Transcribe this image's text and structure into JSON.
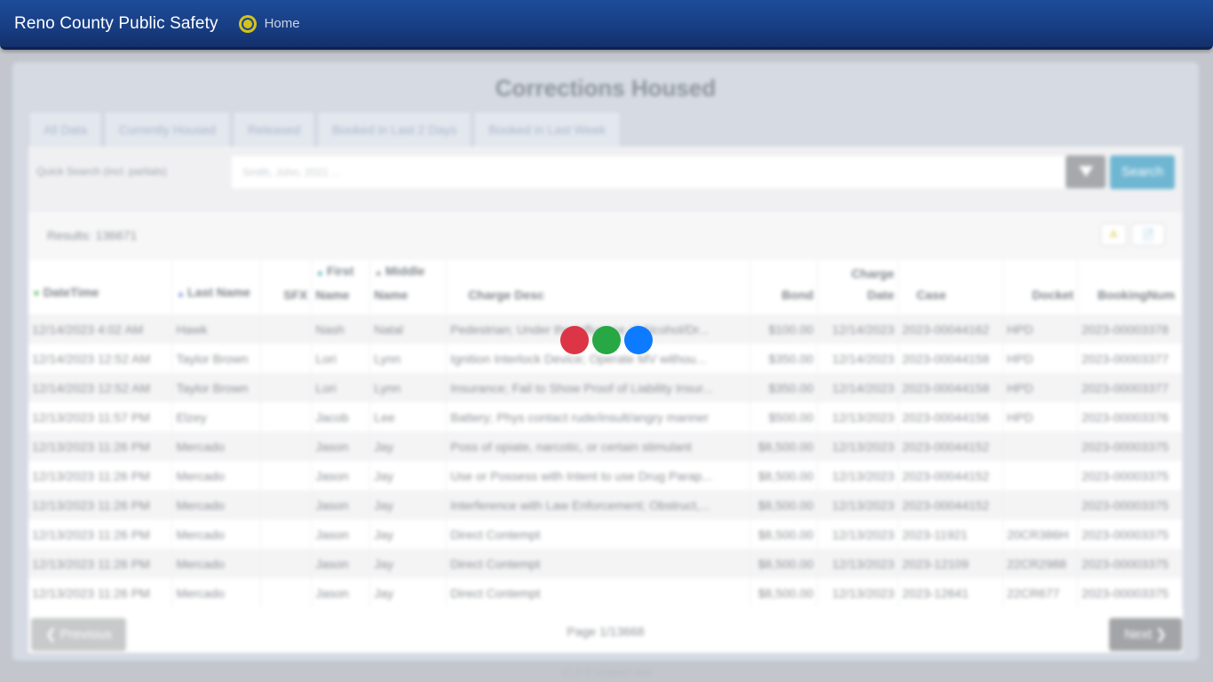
{
  "navbar": {
    "brand": "Reno County Public Safety",
    "home": "Home"
  },
  "panel": {
    "title": "Corrections Housed",
    "tabs": [
      "All Data",
      "Currently Housed",
      "Released",
      "Booked in Last 2 Days",
      "Booked in Last Week"
    ]
  },
  "search": {
    "label": "Quick Search (incl. partials)",
    "placeholder": "Smith, John, 2021 ...",
    "button": "Search"
  },
  "results": {
    "text": "Results: 136671"
  },
  "export": {
    "excel": "A",
    "csv": "📄"
  },
  "table": {
    "columns": [
      "DateTime",
      "Last Name",
      "SFX",
      "First Name",
      "Middle Name",
      "Charge Desc",
      "Bond",
      "Charge Date",
      "Case",
      "Docket",
      "BookingNum"
    ],
    "rows": [
      [
        "12/14/2023 4:02 AM",
        "Hawk",
        "",
        "Nash",
        "Natal",
        "Pedestrian; Under the Influence of Alcohol/Dr...",
        "$100.00",
        "12/14/2023",
        "2023-00044162",
        "HPD",
        "2023-00003378"
      ],
      [
        "12/14/2023 12:52 AM",
        "Taylor Brown",
        "",
        "Lori",
        "Lynn",
        "Ignition Interlock Device; Operate MV withou...",
        "$350.00",
        "12/14/2023",
        "2023-00044158",
        "HPD",
        "2023-00003377"
      ],
      [
        "12/14/2023 12:52 AM",
        "Taylor Brown",
        "",
        "Lori",
        "Lynn",
        "Insurance; Fail to Show Proof of Liability Insur...",
        "$350.00",
        "12/14/2023",
        "2023-00044158",
        "HPD",
        "2023-00003377"
      ],
      [
        "12/13/2023 11:57 PM",
        "Elzey",
        "",
        "Jacob",
        "Lee",
        "Battery; Phys contact rude/insult/angry manner",
        "$500.00",
        "12/13/2023",
        "2023-00044156",
        "HPD",
        "2023-00003376"
      ],
      [
        "12/13/2023 11:26 PM",
        "Mercado",
        "",
        "Jason",
        "Jay",
        "Poss of opiate, narcotic, or certain stimulant",
        "$8,500.00",
        "12/13/2023",
        "2023-00044152",
        "",
        "2023-00003375"
      ],
      [
        "12/13/2023 11:26 PM",
        "Mercado",
        "",
        "Jason",
        "Jay",
        "Use or Possess with Intent to use Drug Parap...",
        "$8,500.00",
        "12/13/2023",
        "2023-00044152",
        "",
        "2023-00003375"
      ],
      [
        "12/13/2023 11:26 PM",
        "Mercado",
        "",
        "Jason",
        "Jay",
        "Interference with Law Enforcement; Obstruct,...",
        "$8,500.00",
        "12/13/2023",
        "2023-00044152",
        "",
        "2023-00003375"
      ],
      [
        "12/13/2023 11:26 PM",
        "Mercado",
        "",
        "Jason",
        "Jay",
        "Direct Contempt",
        "$8,500.00",
        "12/13/2023",
        "2023-11921",
        "20CR386H",
        "2023-00003375"
      ],
      [
        "12/13/2023 11:26 PM",
        "Mercado",
        "",
        "Jason",
        "Jay",
        "Direct Contempt",
        "$8,500.00",
        "12/13/2023",
        "2023-12109",
        "22CR2988",
        "2023-00003375"
      ],
      [
        "12/13/2023 11:26 PM",
        "Mercado",
        "",
        "Jason",
        "Jay",
        "Direct Contempt",
        "$8,500.00",
        "12/13/2023",
        "2023-12641",
        "22CR677",
        "2023-00003375"
      ]
    ]
  },
  "pager": {
    "prev": "Previous",
    "next": "Next",
    "page": "Page 1/13668"
  },
  "footer": {
    "text": "v1.0 © support add"
  },
  "dots": {
    "colors": [
      "#dc3545",
      "#28a745",
      "#0d7bff"
    ]
  }
}
